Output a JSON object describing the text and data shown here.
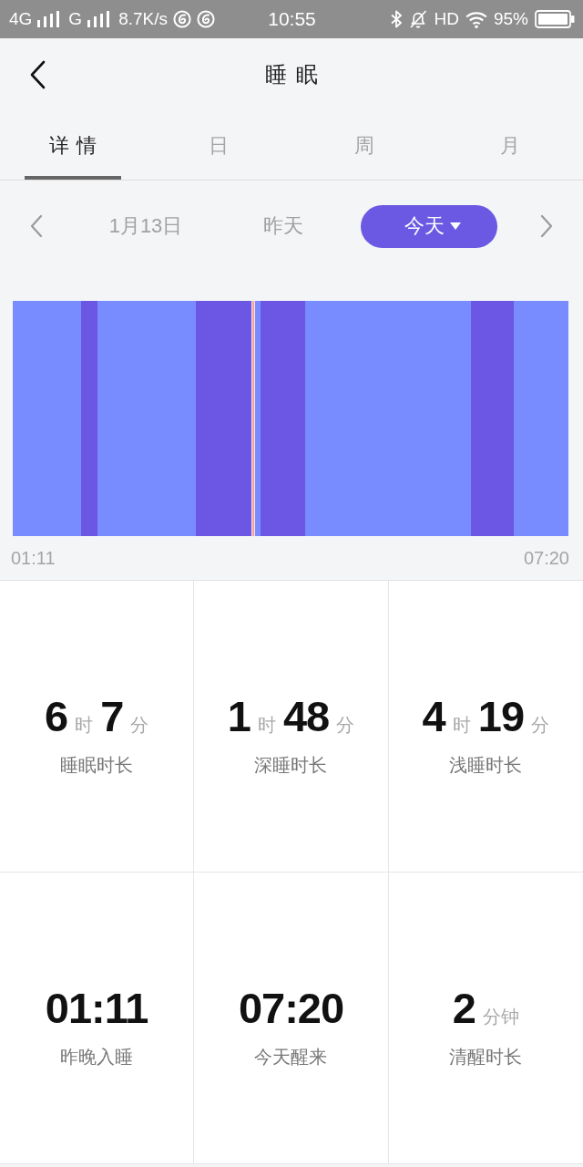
{
  "status_bar": {
    "network_primary": "4G",
    "network_secondary": "G",
    "data_speed": "8.7K/s",
    "time": "10:55",
    "hd": "HD",
    "battery": "95%"
  },
  "header": {
    "title": "睡眠"
  },
  "tabs": [
    {
      "label": "详情",
      "selected": true
    },
    {
      "label": "日",
      "selected": false
    },
    {
      "label": "周",
      "selected": false
    },
    {
      "label": "月",
      "selected": false
    }
  ],
  "date_nav": {
    "dates": [
      {
        "label": "1月13日",
        "selected": false
      },
      {
        "label": "昨天",
        "selected": false
      },
      {
        "label": "今天",
        "selected": true
      }
    ]
  },
  "sleep_chart": {
    "start_time": "01:11",
    "end_time": "07:20"
  },
  "stats": [
    {
      "parts": [
        {
          "value": "6",
          "unit": "时"
        },
        {
          "value": "7",
          "unit": "分"
        }
      ],
      "label": "睡眠时长"
    },
    {
      "parts": [
        {
          "value": "1",
          "unit": "时"
        },
        {
          "value": "48",
          "unit": "分"
        }
      ],
      "label": "深睡时长"
    },
    {
      "parts": [
        {
          "value": "4",
          "unit": "时"
        },
        {
          "value": "19",
          "unit": "分"
        }
      ],
      "label": "浅睡时长"
    },
    {
      "parts": [
        {
          "value": "01:11"
        }
      ],
      "label": "昨晚入睡"
    },
    {
      "parts": [
        {
          "value": "07:20"
        }
      ],
      "label": "今天醒来"
    },
    {
      "parts": [
        {
          "value": "2",
          "unit": "分钟"
        }
      ],
      "label": "清醒时长"
    }
  ]
}
